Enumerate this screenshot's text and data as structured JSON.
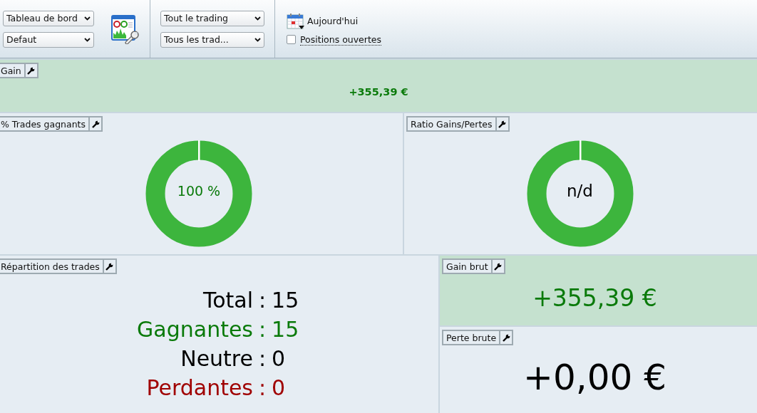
{
  "toolbar": {
    "selects_left": [
      {
        "value": "Tableau de bord"
      },
      {
        "value": "Defaut"
      }
    ],
    "selects_mid": [
      {
        "value": "Tout le trading"
      },
      {
        "value": "Tous les trad..."
      }
    ],
    "date_button": "Aujourd'hui",
    "open_positions": {
      "label": "Positions ouvertes",
      "checked": false
    }
  },
  "gain": {
    "title": "Gain",
    "value": "+355,39 €",
    "highlighted": true,
    "color": "#0a7a0a"
  },
  "donuts": [
    {
      "title": "% Trades gagnants",
      "center": "100 %",
      "level": 1,
      "color": "#0a7a0a"
    },
    {
      "title": "Ratio Gains/Pertes",
      "center": "n/d",
      "level": 1,
      "color": "#000000"
    }
  ],
  "breakdown": {
    "title": "Répartition des trades",
    "lines": [
      {
        "label": "Total",
        "sep": ":",
        "value": "15",
        "color": "#000000"
      },
      {
        "label": "Gagnantes",
        "sep": ":",
        "value": "15",
        "color": "#0a7a0a"
      },
      {
        "label": "Neutre",
        "sep": ":",
        "value": "0",
        "color": "#000000"
      },
      {
        "label": "Perdantes",
        "sep": ":",
        "value": "0",
        "color": "#a00000"
      }
    ]
  },
  "side": [
    {
      "title": "Gain brut",
      "value": "+355,39 €",
      "highlighted": true,
      "color": "#0a7a0a"
    },
    {
      "title": "Perte brute",
      "value": "+0,00 €",
      "highlighted": false,
      "color": "#000000"
    }
  ]
}
